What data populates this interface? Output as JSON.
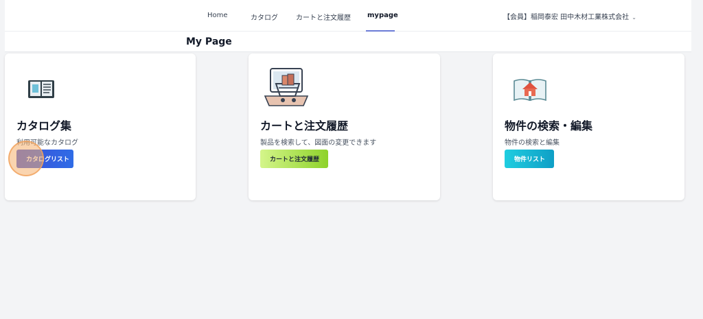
{
  "nav": {
    "items": [
      {
        "label": "Home"
      },
      {
        "label": "カタログ"
      },
      {
        "label": "カートと注文履歴"
      },
      {
        "label": "mypage",
        "active": true
      }
    ],
    "user": "【会員】稲岡泰宏 田中木材工業株式会社"
  },
  "page": {
    "title": "My Page"
  },
  "cards": [
    {
      "title": "カタログ集",
      "description": "利用可能なカタログ",
      "button": "カタログリスト",
      "icon": "open-book-icon",
      "button_color": "#3b4fd8"
    },
    {
      "title": "カートと注文履歴",
      "description": "製品を検索して、図面の変更できます",
      "button": "カートと注文履歴",
      "icon": "laptop-cart-icon",
      "button_color": "#a6e34a"
    },
    {
      "title": "物件の検索・編集",
      "description": "物件の検索と編集",
      "button": "物件リスト",
      "icon": "house-book-icon",
      "button_color": "#14b8d4"
    }
  ]
}
